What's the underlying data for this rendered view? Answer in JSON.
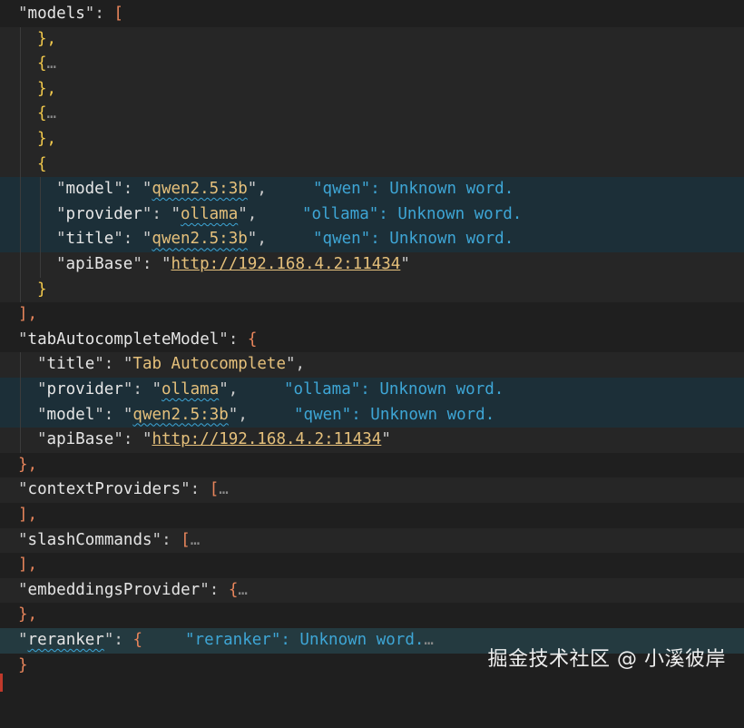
{
  "code": {
    "l1_key": "models",
    "l1_sep": ": ",
    "l1_open": "[",
    "l2": "},",
    "l3_open": "{",
    "l3_fold": "…",
    "l4": "},",
    "l5_open": "{",
    "l5_fold": "…",
    "l6": "},",
    "l7_open": "{",
    "model_key": "model",
    "model_val": "qwen2.5:3b",
    "model_diag": "\"qwen\": Unknown word.",
    "provider_key": "provider",
    "provider_val": "ollama",
    "provider_diag": "\"ollama\": Unknown word.",
    "title_key": "title",
    "title_val": "qwen2.5:3b",
    "title_diag": "\"qwen\": Unknown word.",
    "apibase_key": "apiBase",
    "apibase_val": "http://192.168.4.2:11434",
    "l12_close": "}",
    "l13_close": "],",
    "tab_key": "tabAutocompleteModel",
    "tab_open": "{",
    "tab_title_key": "title",
    "tab_title_val": "Tab Autocomplete",
    "tab_provider_key": "provider",
    "tab_provider_val": "ollama",
    "tab_provider_diag": "\"ollama\": Unknown word.",
    "tab_model_key": "model",
    "tab_model_val": "qwen2.5:3b",
    "tab_model_diag": "\"qwen\": Unknown word.",
    "tab_apibase_key": "apiBase",
    "tab_apibase_val": "http://192.168.4.2:11434",
    "tab_close": "},",
    "ctx_key": "contextProviders",
    "ctx_open": "[",
    "ctx_fold": "…",
    "ctx_close": "],",
    "slash_key": "slashCommands",
    "slash_open": "[",
    "slash_fold": "…",
    "slash_close": "],",
    "emb_key": "embeddingsProvider",
    "emb_open": "{",
    "emb_fold": "…",
    "emb_close": "},",
    "rerank_key": "reranker",
    "rerank_open": "{",
    "rerank_diag": "\"reranker\": Unknown word.",
    "rerank_fold": "…",
    "rerank_close": "}"
  },
  "watermark": "掘金技术社区 @ 小溪彼岸",
  "colors": {
    "background": "#1f1f1f",
    "string": "#e5c07b",
    "diagnostic": "#3ea6d6",
    "bracket_orange": "#e8855b",
    "brace_yellow": "#f2c94c",
    "highlight": "#1c2f38"
  }
}
